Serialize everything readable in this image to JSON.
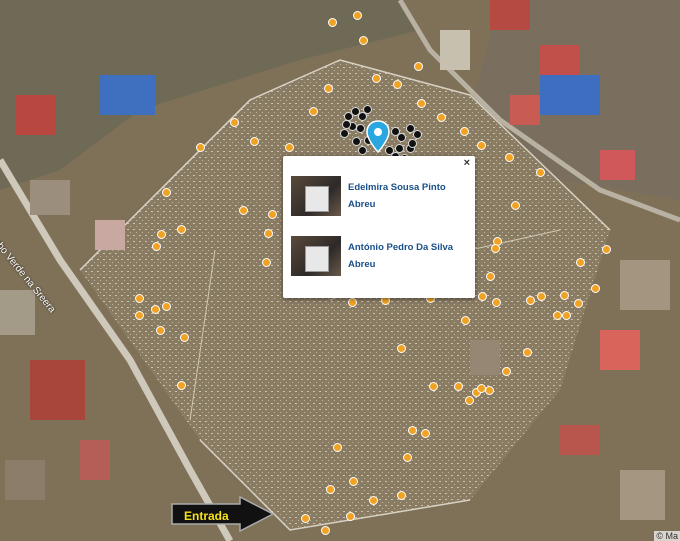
{
  "popup": {
    "close_label": "×",
    "entries": [
      {
        "name": "Edelmira Sousa Pinto Abreu"
      },
      {
        "name": "António Pedro Da Silva Abreu"
      }
    ]
  },
  "entrance_label": "Entrada",
  "street_label": "de Cabo Verde na Sreera",
  "attribution": "© Ma",
  "colors": {
    "marker": "#f0a224",
    "marker_cluster": "#111111",
    "pin": "#2aa7e0",
    "link": "#1a4f8a"
  }
}
